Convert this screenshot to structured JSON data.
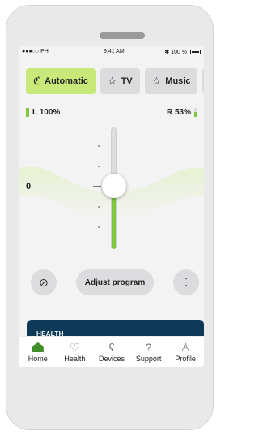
{
  "status": {
    "carrier": "●●●○○ PH",
    "time": "9:41 AM",
    "battery": "100 %"
  },
  "tabs": [
    {
      "label": "Automatic",
      "icon": "ear-signal-icon",
      "active": true
    },
    {
      "label": "TV",
      "icon": "star-icon",
      "active": false
    },
    {
      "label": "Music",
      "icon": "star-icon",
      "active": false
    }
  ],
  "battery_left": {
    "label": "L 100%",
    "level": 1.0
  },
  "battery_right": {
    "label": "R 53%",
    "level": 0.53
  },
  "volume": {
    "value": "0"
  },
  "actions": {
    "mute_icon": "mute-icon",
    "adjust_label": "Adjust program",
    "equalizer_icon": "equalizer-icon"
  },
  "health": {
    "title": "HEALTH"
  },
  "nav": [
    {
      "label": "Home",
      "icon": "home-icon",
      "active": true
    },
    {
      "label": "Health",
      "icon": "heart-icon",
      "active": false
    },
    {
      "label": "Devices",
      "icon": "hearing-aid-icon",
      "active": false
    },
    {
      "label": "Support",
      "icon": "help-icon",
      "active": false
    },
    {
      "label": "Profile",
      "icon": "profile-icon",
      "active": false
    }
  ],
  "colors": {
    "accent": "#c8e87a",
    "green": "#7ec63e",
    "navy": "#0e3a57"
  }
}
